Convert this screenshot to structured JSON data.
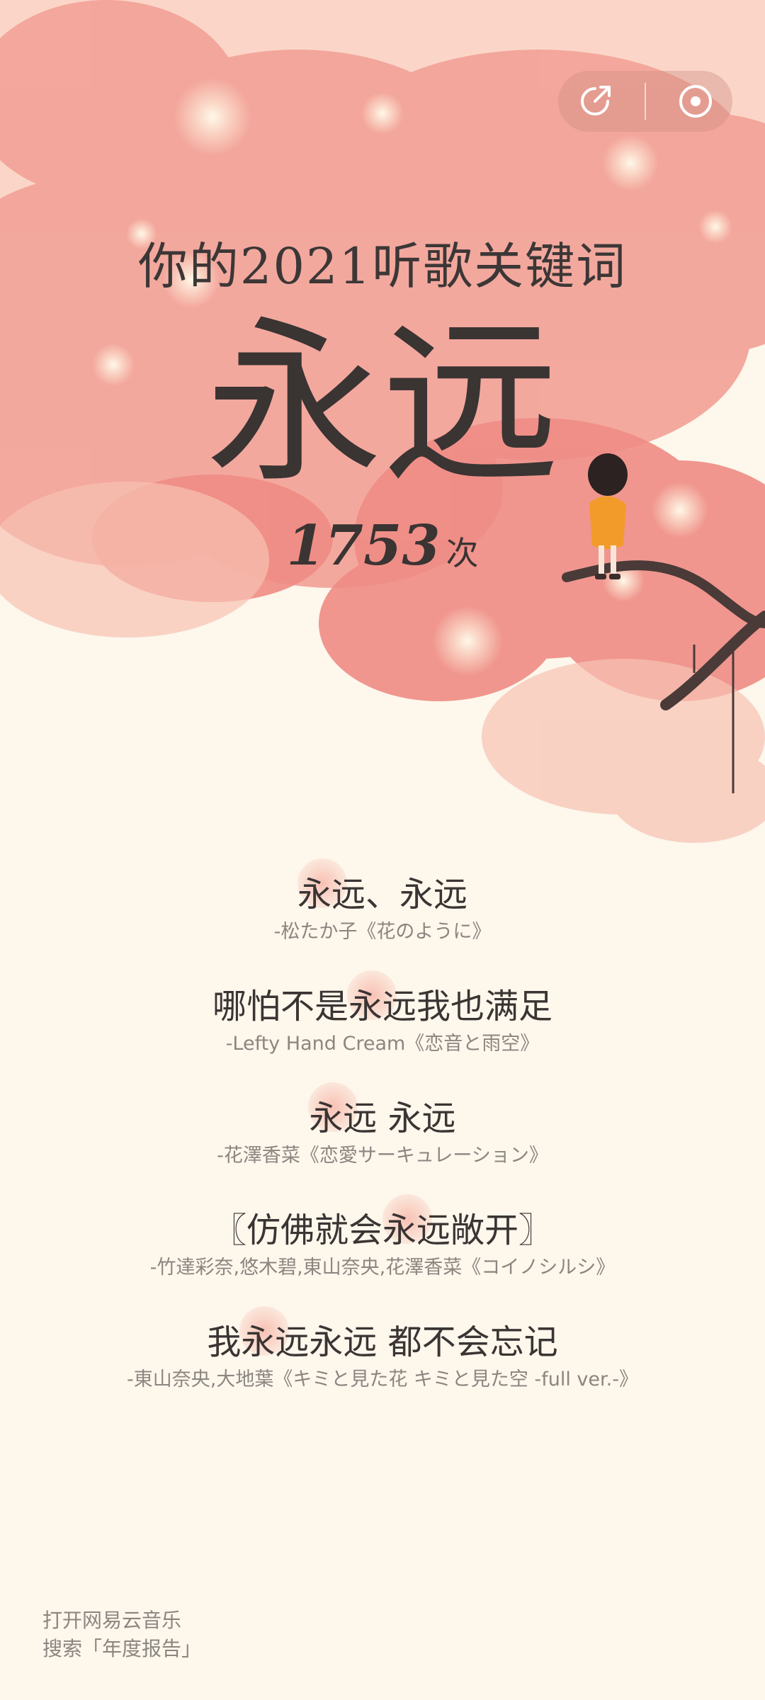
{
  "header": {
    "title": "你的2021听歌关键词"
  },
  "keyword": {
    "word": "永远",
    "count": "1753",
    "unit": "次"
  },
  "actions": {
    "share_icon": "share-icon",
    "music_icon": "disc-icon"
  },
  "lyrics": [
    {
      "line": "永远、永远",
      "source": "-松たか子《花のように》"
    },
    {
      "line": "哪怕不是永远我也满足",
      "source": "-Lefty Hand Cream《恋音と雨空》"
    },
    {
      "line": "永远 永远",
      "source": "-花澤香菜《恋愛サーキュレーション》"
    },
    {
      "line": "〖仿佛就会永远敞开〗",
      "source": "-竹達彩奈,悠木碧,東山奈央,花澤香菜《コイノシルシ》"
    },
    {
      "line": "我永远永远 都不会忘记",
      "source": "-東山奈央,大地葉《キミと見た花 キミと見た空 -full ver.-》"
    }
  ],
  "footer": {
    "line1": "打开网易云音乐",
    "line2": "搜索「年度报告」"
  },
  "colors": {
    "background": "#fdf7ec",
    "blossom": "#f2998f",
    "text": "#3a3433",
    "subtext": "#8c8580"
  }
}
